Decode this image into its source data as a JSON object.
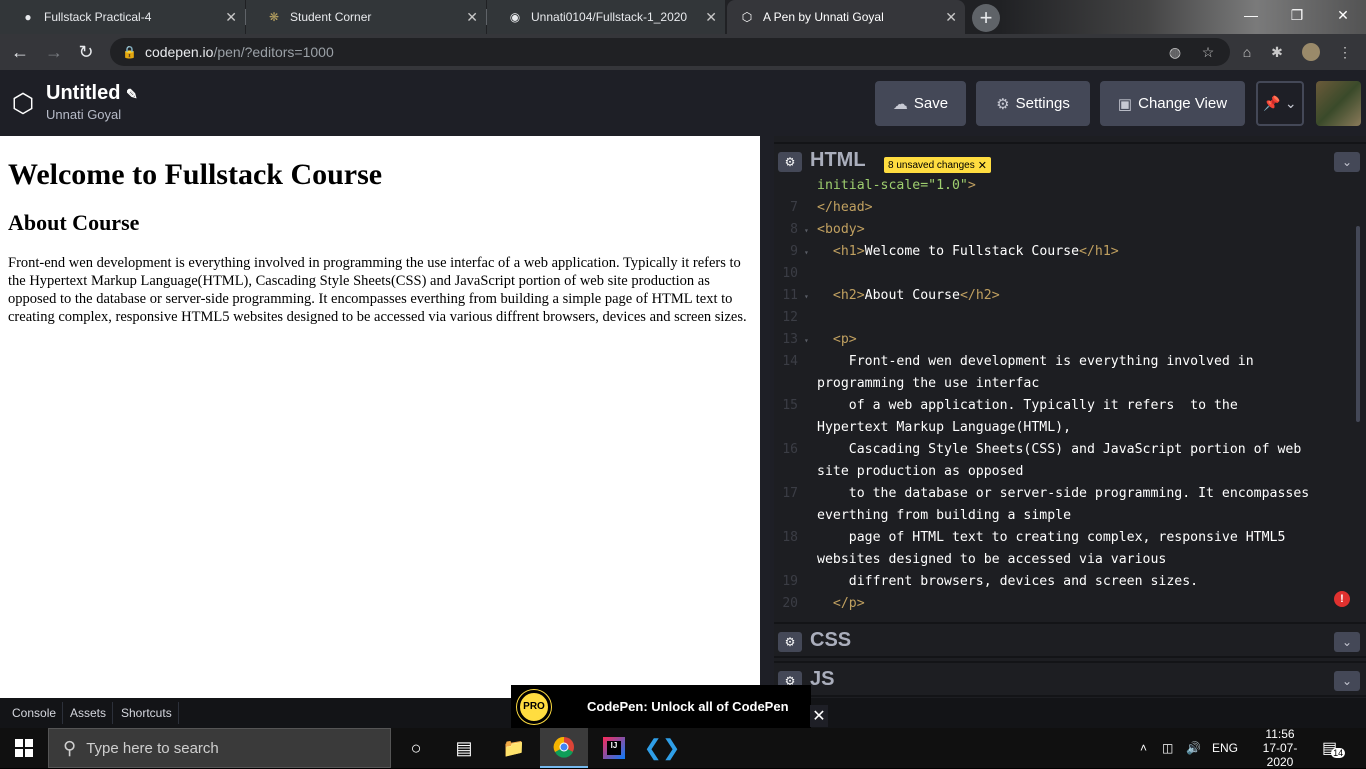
{
  "browser": {
    "tabs": [
      {
        "title": "Fullstack Practical-4",
        "icon": "classroom-icon"
      },
      {
        "title": "Student Corner",
        "icon": "student-icon"
      },
      {
        "title": "Unnati0104/Fullstack-1_2020",
        "icon": "github-icon"
      },
      {
        "title": "A Pen by Unnati Goyal",
        "icon": "codepen-icon",
        "active": true
      }
    ],
    "url_host": "codepen.io",
    "url_path": "/pen/?editors=1000"
  },
  "codepen": {
    "title": "Untitled",
    "user": "Unnati Goyal",
    "buttons": {
      "save": "Save",
      "settings": "Settings",
      "change_view": "Change View"
    }
  },
  "preview": {
    "h1": "Welcome to Fullstack Course",
    "h2": "About Course",
    "p": "Front-end wen development is everything involved in programming the use interfac of a web application. Typically it refers to the Hypertext Markup Language(HTML), Cascading Style Sheets(CSS) and JavaScript portion of web site production as opposed to the database or server-side programming. It encompasses everthing from building a simple page of HTML text to creating complex, responsive HTML5 websites designed to be accessed via various diffrent browsers, devices and screen sizes."
  },
  "editor": {
    "html_label": "HTML",
    "unsaved_badge": "8 unsaved changes",
    "css_label": "CSS",
    "js_label": "JS",
    "lines": [
      {
        "n": "",
        "parts": [
          [
            "str",
            "initial-scale=\"1.0\""
          ],
          [
            "tg",
            ">"
          ]
        ]
      },
      {
        "n": "7",
        "parts": [
          [
            "tg",
            "</head>"
          ]
        ]
      },
      {
        "n": "8",
        "fold": true,
        "parts": [
          [
            "tg",
            "<body>"
          ]
        ]
      },
      {
        "n": "9",
        "fold": true,
        "parts": [
          [
            "tx",
            "  "
          ],
          [
            "tg",
            "<h1>"
          ],
          [
            "tx",
            "Welcome to Fullstack Course"
          ],
          [
            "tg",
            "</h1>"
          ]
        ]
      },
      {
        "n": "10",
        "parts": []
      },
      {
        "n": "11",
        "fold": true,
        "parts": [
          [
            "tx",
            "  "
          ],
          [
            "tg",
            "<h2>"
          ],
          [
            "tx",
            "About Course"
          ],
          [
            "tg",
            "</h2>"
          ]
        ]
      },
      {
        "n": "12",
        "parts": []
      },
      {
        "n": "13",
        "fold": true,
        "parts": [
          [
            "tx",
            "  "
          ],
          [
            "tg",
            "<p>"
          ]
        ]
      },
      {
        "n": "14",
        "parts": [
          [
            "tx",
            "    Front-end wen development is everything involved in"
          ]
        ]
      },
      {
        "n": "",
        "parts": [
          [
            "tx",
            "programming the use interfac"
          ]
        ]
      },
      {
        "n": "15",
        "parts": [
          [
            "tx",
            "    of a web application. Typically it refers  to the"
          ]
        ]
      },
      {
        "n": "",
        "parts": [
          [
            "tx",
            "Hypertext Markup Language(HTML),"
          ]
        ]
      },
      {
        "n": "16",
        "parts": [
          [
            "tx",
            "    Cascading Style Sheets(CSS) and JavaScript portion of web"
          ]
        ]
      },
      {
        "n": "",
        "parts": [
          [
            "tx",
            "site production as opposed"
          ]
        ]
      },
      {
        "n": "17",
        "parts": [
          [
            "tx",
            "    to the database or server-side programming. It encompasses"
          ]
        ]
      },
      {
        "n": "",
        "parts": [
          [
            "tx",
            "everthing from building a simple"
          ]
        ]
      },
      {
        "n": "18",
        "parts": [
          [
            "tx",
            "    page of HTML text to creating complex, responsive HTML5"
          ]
        ]
      },
      {
        "n": "",
        "parts": [
          [
            "tx",
            "websites designed to be accessed via various"
          ]
        ]
      },
      {
        "n": "19",
        "parts": [
          [
            "tx",
            "    diffrent browsers, devices and screen sizes."
          ]
        ]
      },
      {
        "n": "20",
        "parts": [
          [
            "tx",
            "  "
          ],
          [
            "tg",
            "</p>"
          ]
        ]
      }
    ]
  },
  "footer": {
    "console": "Console",
    "assets": "Assets",
    "shortcuts": "Shortcuts",
    "promo_badge": "PRO",
    "promo_text": "CodePen: Unlock all of CodePen"
  },
  "taskbar": {
    "search_placeholder": "Type here to search",
    "lang": "ENG",
    "time": "11:56",
    "date": "17-07-2020",
    "notifications": "14"
  }
}
